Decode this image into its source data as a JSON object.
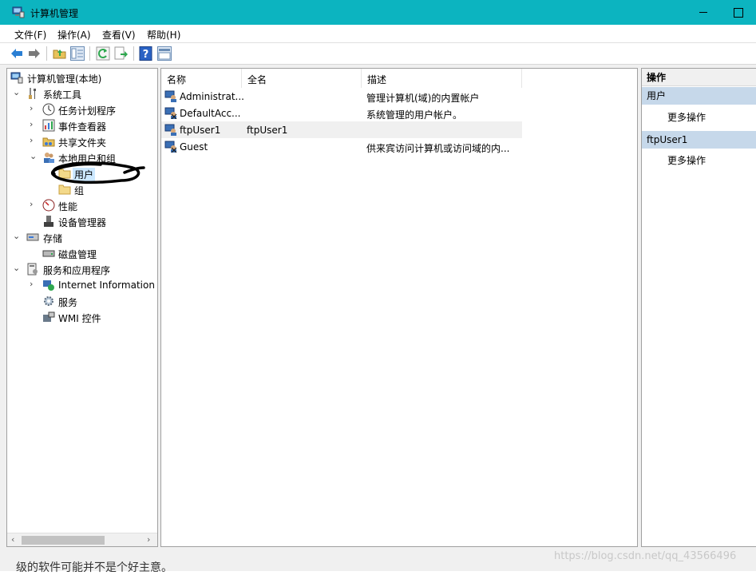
{
  "window": {
    "title": "计算机管理"
  },
  "menu": [
    "文件(F)",
    "操作(A)",
    "查看(V)",
    "帮助(H)"
  ],
  "toolbar": {
    "icons": [
      "back-icon",
      "forward-icon",
      "up-folder-icon",
      "show-tree-icon",
      "refresh-icon",
      "export-list-icon",
      "help-icon",
      "action-pane-icon"
    ]
  },
  "tree": {
    "root": "计算机管理(本地)",
    "system_tools": "系统工具",
    "task_scheduler": "任务计划程序",
    "event_viewer": "事件查看器",
    "shared_folders": "共享文件夹",
    "local_users": "本地用户和组",
    "users": "用户",
    "groups": "组",
    "performance": "性能",
    "device_manager": "设备管理器",
    "storage": "存储",
    "disk_management": "磁盘管理",
    "services_apps": "服务和应用程序",
    "iis": "Internet Information S",
    "services": "服务",
    "wmi": "WMI 控件",
    "selected": "用户"
  },
  "list": {
    "columns": [
      "名称",
      "全名",
      "描述"
    ],
    "rows": [
      {
        "name": "Administrat...",
        "fullname": "",
        "description": "管理计算机(域)的内置帐户"
      },
      {
        "name": "DefaultAcc...",
        "fullname": "",
        "description": "系统管理的用户帐户。"
      },
      {
        "name": "ftpUser1",
        "fullname": "ftpUser1",
        "description": ""
      },
      {
        "name": "Guest",
        "fullname": "",
        "description": "供来宾访问计算机或访问域的内..."
      }
    ]
  },
  "actions": {
    "header": "操作",
    "groups": [
      {
        "title": "用户",
        "link": "更多操作"
      },
      {
        "title": "ftpUser1",
        "link": "更多操作"
      }
    ]
  },
  "background_text": "级的软件可能并不是个好主意。",
  "watermark": "https://blog.csdn.net/qq_43566496",
  "colors": {
    "titlebar": "#0cb4c0",
    "selection": "#cce8ff",
    "action_group": "#c6d8ea"
  }
}
